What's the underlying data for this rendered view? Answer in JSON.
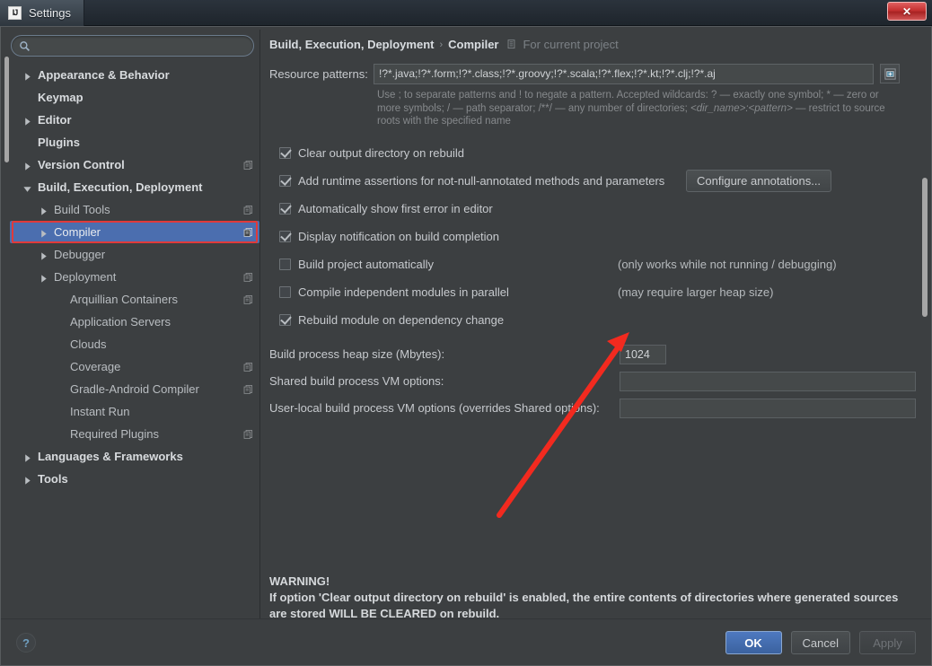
{
  "window": {
    "title": "Settings",
    "logo_text": "IJ",
    "close_label": "✕"
  },
  "search": {
    "placeholder": "",
    "value": "",
    "icon": "search-icon"
  },
  "sidebar": {
    "items": [
      {
        "label": "Appearance & Behavior",
        "depth": 0,
        "arrow": "collapsed",
        "bold": true,
        "mod_icon": false,
        "selected": false
      },
      {
        "label": "Keymap",
        "depth": 0,
        "arrow": "none",
        "bold": true,
        "mod_icon": false,
        "selected": false
      },
      {
        "label": "Editor",
        "depth": 0,
        "arrow": "collapsed",
        "bold": true,
        "mod_icon": false,
        "selected": false
      },
      {
        "label": "Plugins",
        "depth": 0,
        "arrow": "none",
        "bold": true,
        "mod_icon": false,
        "selected": false
      },
      {
        "label": "Version Control",
        "depth": 0,
        "arrow": "collapsed",
        "bold": true,
        "mod_icon": true,
        "selected": false
      },
      {
        "label": "Build, Execution, Deployment",
        "depth": 0,
        "arrow": "expanded",
        "bold": true,
        "mod_icon": false,
        "selected": false
      },
      {
        "label": "Build Tools",
        "depth": 1,
        "arrow": "collapsed",
        "bold": false,
        "mod_icon": true,
        "selected": false
      },
      {
        "label": "Compiler",
        "depth": 1,
        "arrow": "collapsed",
        "bold": false,
        "mod_icon": true,
        "selected": true
      },
      {
        "label": "Debugger",
        "depth": 1,
        "arrow": "collapsed",
        "bold": false,
        "mod_icon": false,
        "selected": false
      },
      {
        "label": "Deployment",
        "depth": 1,
        "arrow": "collapsed",
        "bold": false,
        "mod_icon": true,
        "selected": false
      },
      {
        "label": "Arquillian Containers",
        "depth": 2,
        "arrow": "none",
        "bold": false,
        "mod_icon": true,
        "selected": false
      },
      {
        "label": "Application Servers",
        "depth": 2,
        "arrow": "none",
        "bold": false,
        "mod_icon": false,
        "selected": false
      },
      {
        "label": "Clouds",
        "depth": 2,
        "arrow": "none",
        "bold": false,
        "mod_icon": false,
        "selected": false
      },
      {
        "label": "Coverage",
        "depth": 2,
        "arrow": "none",
        "bold": false,
        "mod_icon": true,
        "selected": false
      },
      {
        "label": "Gradle-Android Compiler",
        "depth": 2,
        "arrow": "none",
        "bold": false,
        "mod_icon": true,
        "selected": false
      },
      {
        "label": "Instant Run",
        "depth": 2,
        "arrow": "none",
        "bold": false,
        "mod_icon": false,
        "selected": false
      },
      {
        "label": "Required Plugins",
        "depth": 2,
        "arrow": "none",
        "bold": false,
        "mod_icon": true,
        "selected": false
      },
      {
        "label": "Languages & Frameworks",
        "depth": 0,
        "arrow": "collapsed",
        "bold": true,
        "mod_icon": false,
        "selected": false
      },
      {
        "label": "Tools",
        "depth": 0,
        "arrow": "collapsed",
        "bold": true,
        "mod_icon": false,
        "selected": false
      }
    ]
  },
  "breadcrumb": {
    "root": "Build, Execution, Deployment",
    "separator": "›",
    "leaf": "Compiler",
    "scope_icon": "project-module-icon",
    "scope_text": "For current project"
  },
  "resource_patterns": {
    "label": "Resource patterns:",
    "value": "!?*.java;!?*.form;!?*.class;!?*.groovy;!?*.scala;!?*.flex;!?*.kt;!?*.clj;!?*.aj",
    "placeholder": "",
    "expand_icon": "expand-editor-icon",
    "hint_part1": "Use ; to separate patterns and ! to negate a pattern. Accepted wildcards: ? — exactly one symbol; * — zero or more symbols; / — path separator; /**/ — any number of directories; ",
    "hint_italic": "<dir_name>:<pattern>",
    "hint_part2": " — restrict to source roots with the specified name"
  },
  "checkboxes": [
    {
      "label": "Clear output directory on rebuild",
      "checked": true,
      "enabled": true,
      "note": "",
      "mnemonic": "l"
    },
    {
      "label": "Add runtime assertions for not-null-annotated methods and parameters",
      "checked": true,
      "enabled": true,
      "note": "",
      "mnemonic": "a"
    },
    {
      "label": "Automatically show first error in editor",
      "checked": true,
      "enabled": true,
      "note": "",
      "mnemonic": "e"
    },
    {
      "label": "Display notification on build completion",
      "checked": true,
      "enabled": true,
      "note": "",
      "mnemonic": ""
    },
    {
      "label": "Build project automatically",
      "checked": false,
      "enabled": true,
      "note": "(only works while not running / debugging)",
      "mnemonic": ""
    },
    {
      "label": "Compile independent modules in parallel",
      "checked": false,
      "enabled": true,
      "note": "(may require larger heap size)",
      "mnemonic": ""
    },
    {
      "label": "Rebuild module on dependency change",
      "checked": true,
      "enabled": true,
      "note": "",
      "mnemonic": ""
    }
  ],
  "configure_annotations_button": "Configure annotations...",
  "fields": {
    "heap_label": "Build process heap size (Mbytes):",
    "heap_value": "1024",
    "heap_placeholder": "",
    "shared_vm_label": "Shared build process VM options:",
    "shared_vm_value": "",
    "shared_vm_placeholder": "",
    "userlocal_vm_label": "User-local build process VM options (overrides Shared options):",
    "userlocal_vm_value": "",
    "userlocal_vm_placeholder": ""
  },
  "warning": {
    "title": "WARNING!",
    "line1": "If option 'Clear output directory on rebuild' is enabled, the entire contents of directories where generated sources",
    "line2": "are stored WILL BE CLEARED on rebuild."
  },
  "footer": {
    "help_label": "?",
    "ok_label": "OK",
    "cancel_label": "Cancel",
    "apply_label": "Apply"
  },
  "annotation": {
    "arrow_color": "#f22a1f",
    "highlight_color": "#e03a3a"
  }
}
